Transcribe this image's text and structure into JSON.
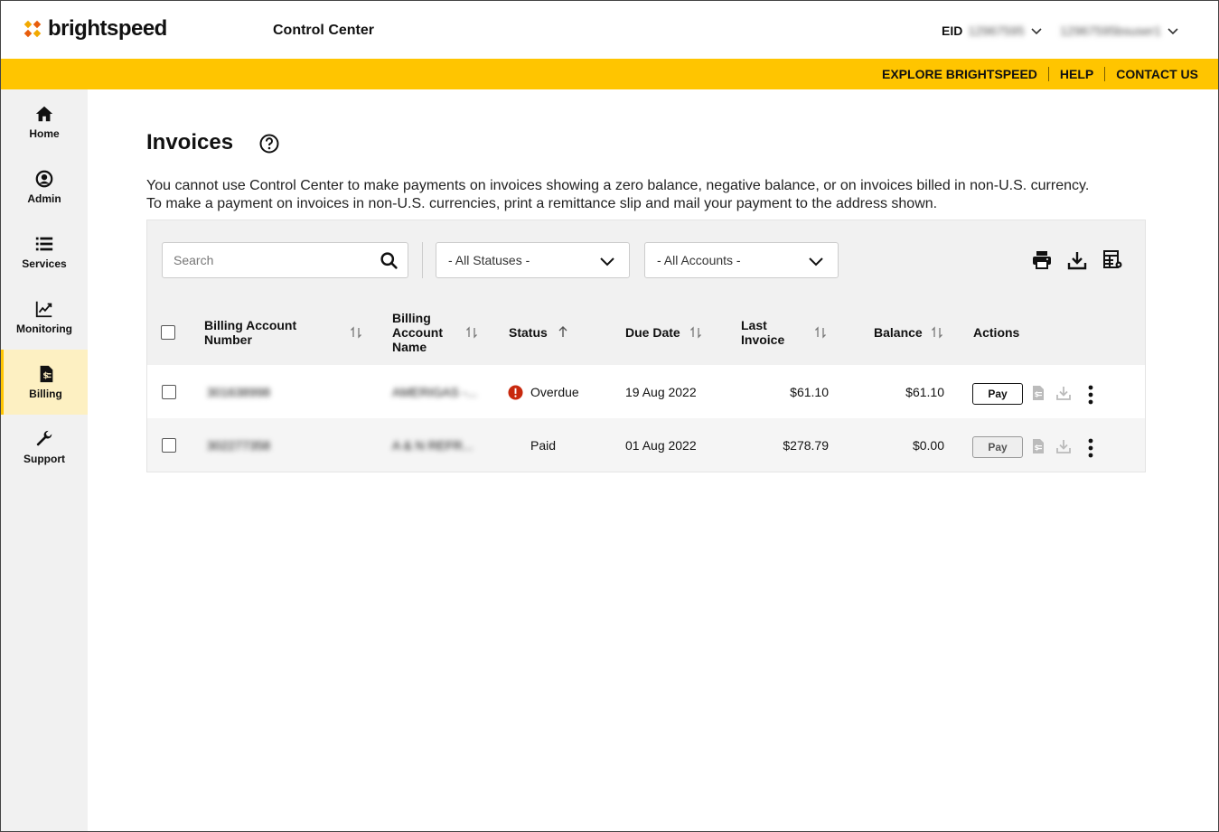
{
  "brand": {
    "name": "brightspeed",
    "accent": "#FFC500"
  },
  "header": {
    "app_title": "Control Center",
    "eid_label": "EID",
    "eid_value": "12967595",
    "user": "12967595bsuser1"
  },
  "utility_links": [
    "EXPLORE BRIGHTSPEED",
    "HELP",
    "CONTACT US"
  ],
  "sidebar": {
    "items": [
      {
        "label": "Home",
        "icon": "home-icon"
      },
      {
        "label": "Admin",
        "icon": "user-circle-icon"
      },
      {
        "label": "Services",
        "icon": "list-icon"
      },
      {
        "label": "Monitoring",
        "icon": "chart-line-icon"
      },
      {
        "label": "Billing",
        "icon": "invoice-dollar-icon",
        "active": true
      },
      {
        "label": "Support",
        "icon": "wrench-icon"
      }
    ]
  },
  "page": {
    "title": "Invoices",
    "notice": "You cannot use Control Center to make payments on invoices showing a zero balance, negative balance, or on invoices billed in non-U.S. currency. To make a payment on invoices in non-U.S. currencies, print a remittance slip and mail your payment to the address shown."
  },
  "filters": {
    "search_placeholder": "Search",
    "status_select": "- All Statuses -",
    "account_select": "- All Accounts -"
  },
  "table": {
    "columns": {
      "account_number": "Billing Account Number",
      "account_name_1": "Billing",
      "account_name_2": "Account",
      "account_name_3": "Name",
      "status": "Status",
      "due_date": "Due Date",
      "last_invoice_1": "Last",
      "last_invoice_2": "Invoice",
      "balance": "Balance",
      "actions": "Actions"
    },
    "rows": [
      {
        "account_number": "301638998",
        "account_name": "AMERIGAS -...",
        "status": "Overdue",
        "due_date": "19 Aug 2022",
        "last_invoice": "$61.10",
        "balance": "$61.10",
        "pay": "Pay"
      },
      {
        "account_number": "302277358",
        "account_name": "A & N REFR...",
        "status": "Paid",
        "due_date": "01 Aug 2022",
        "last_invoice": "$278.79",
        "balance": "$0.00",
        "pay": "Pay"
      }
    ]
  }
}
